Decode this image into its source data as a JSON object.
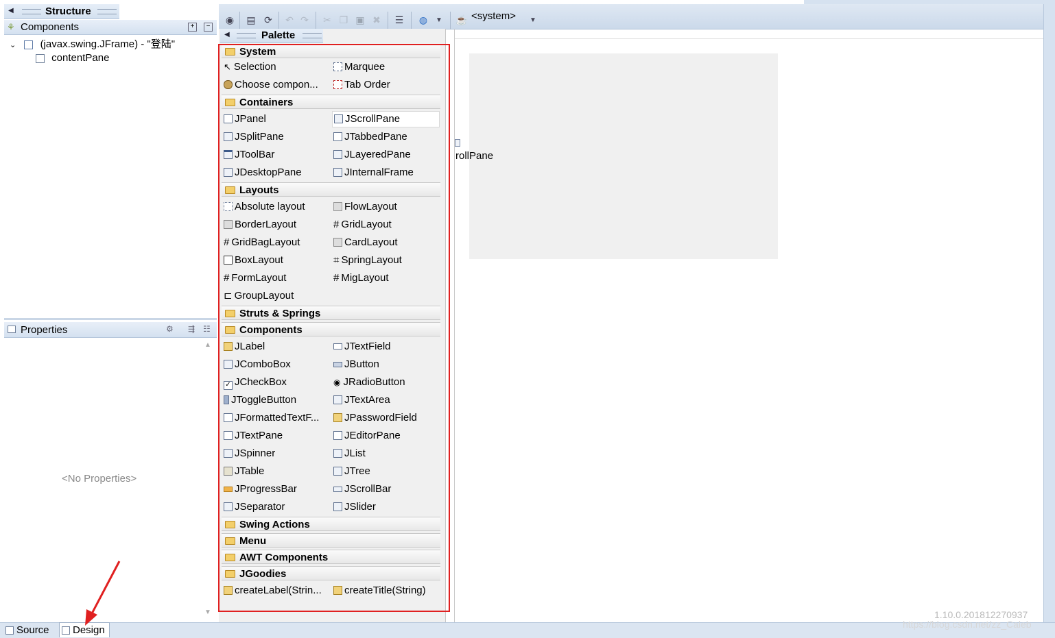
{
  "structure": {
    "title": "Structure"
  },
  "components": {
    "title": "Components",
    "tree": [
      {
        "label": "(javax.swing.JFrame) - \"登陆\"",
        "expanded": true
      },
      {
        "label": "contentPane"
      }
    ]
  },
  "properties": {
    "title": "Properties",
    "empty_text": "<No Properties>"
  },
  "toolbar": {
    "system_combo": "<system>"
  },
  "palette": {
    "title": "Palette",
    "categories": [
      {
        "name": "System",
        "items": [
          "Selection",
          "Marquee",
          "Choose compon...",
          "Tab Order"
        ]
      },
      {
        "name": "Containers",
        "items": [
          "JPanel",
          "JScrollPane",
          "JSplitPane",
          "JTabbedPane",
          "JToolBar",
          "JLayeredPane",
          "JDesktopPane",
          "JInternalFrame"
        ]
      },
      {
        "name": "Layouts",
        "items": [
          "Absolute layout",
          "FlowLayout",
          "BorderLayout",
          "GridLayout",
          "GridBagLayout",
          "CardLayout",
          "BoxLayout",
          "SpringLayout",
          "FormLayout",
          "MigLayout",
          "GroupLayout"
        ]
      },
      {
        "name": "Struts & Springs",
        "items": []
      },
      {
        "name": "Components",
        "items": [
          "JLabel",
          "JTextField",
          "JComboBox",
          "JButton",
          "JCheckBox",
          "JRadioButton",
          "JToggleButton",
          "JTextArea",
          "JFormattedTextF...",
          "JPasswordField",
          "JTextPane",
          "JEditorPane",
          "JSpinner",
          "JList",
          "JTable",
          "JTree",
          "JProgressBar",
          "JScrollBar",
          "JSeparator",
          "JSlider"
        ]
      },
      {
        "name": "Swing Actions",
        "items": []
      },
      {
        "name": "Menu",
        "items": []
      },
      {
        "name": "AWT Components",
        "items": []
      },
      {
        "name": "JGoodies",
        "items": [
          "createLabel(Strin...",
          "createTitle(String)"
        ]
      }
    ]
  },
  "canvas": {
    "fragment_label": "rollPane"
  },
  "tabs": {
    "source": "Source",
    "design": "Design"
  },
  "version": "1.10.0.201812270937",
  "watermark": "https://blog.csdn.net/zz_Caleb",
  "colors": {
    "highlight_border": "#e02020",
    "header_bg": "#d6e2f0",
    "arrow": "#e02020"
  }
}
